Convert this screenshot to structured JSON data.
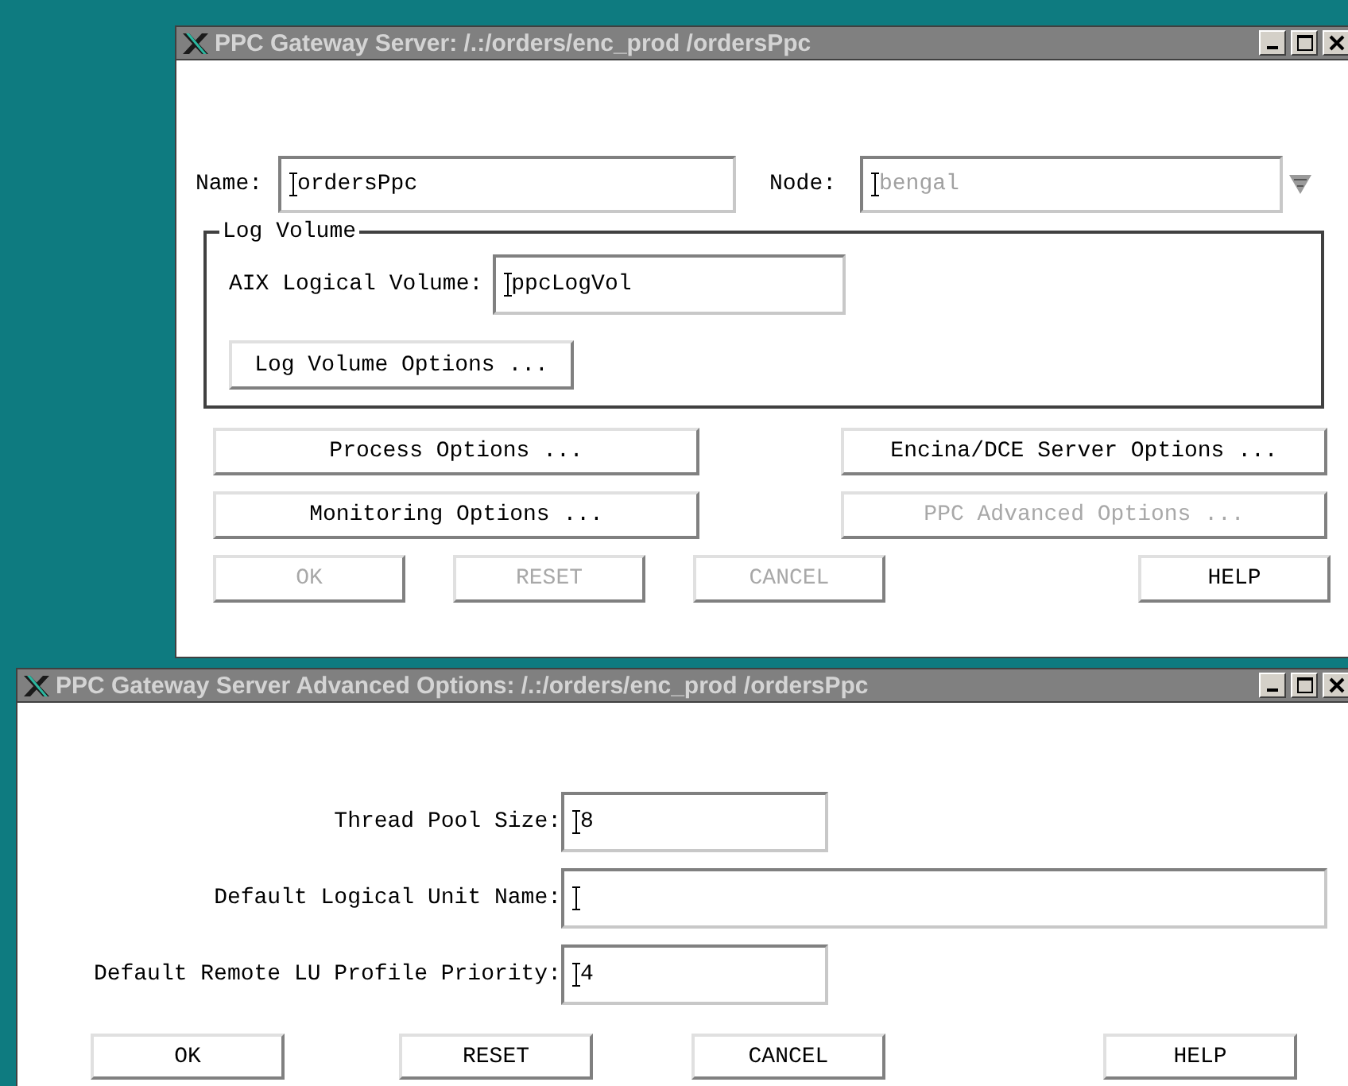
{
  "main_window": {
    "title": "PPC Gateway Server: /.:/orders/enc_prod /ordersPpc",
    "name_field": {
      "label": "Name:",
      "value": "ordersPpc"
    },
    "node_field": {
      "label": "Node:",
      "value": "bengal",
      "disabled": true
    },
    "log_volume": {
      "legend": "Log Volume",
      "field": {
        "label": "AIX Logical Volume:",
        "value": "ppcLogVol"
      },
      "button": "Log Volume Options ..."
    },
    "option_buttons": [
      {
        "label": "Process Options ...",
        "disabled": false
      },
      {
        "label": "Encina/DCE Server Options ...",
        "disabled": false
      },
      {
        "label": "Monitoring Options ...",
        "disabled": false
      },
      {
        "label": "PPC Advanced Options ...",
        "disabled": true
      }
    ],
    "buttons": [
      {
        "label": "OK",
        "disabled": true
      },
      {
        "label": "RESET",
        "disabled": true
      },
      {
        "label": "CANCEL",
        "disabled": true
      },
      {
        "label": "HELP",
        "disabled": false
      }
    ]
  },
  "advanced_window": {
    "title": "PPC Gateway Server Advanced Options: /.:/orders/enc_prod /ordersPpc",
    "fields": [
      {
        "label": "Thread Pool Size:",
        "value": "8",
        "kind": "short"
      },
      {
        "label": "Default Logical Unit Name:",
        "kind": "long"
      },
      {
        "label": "Default Remote LU Profile Priority:",
        "value": "4",
        "kind": "short"
      }
    ],
    "buttons": [
      {
        "label": "OK",
        "disabled": false
      },
      {
        "label": "RESET",
        "disabled": false
      },
      {
        "label": "CANCEL",
        "disabled": false
      },
      {
        "label": "HELP",
        "disabled": false
      }
    ]
  }
}
